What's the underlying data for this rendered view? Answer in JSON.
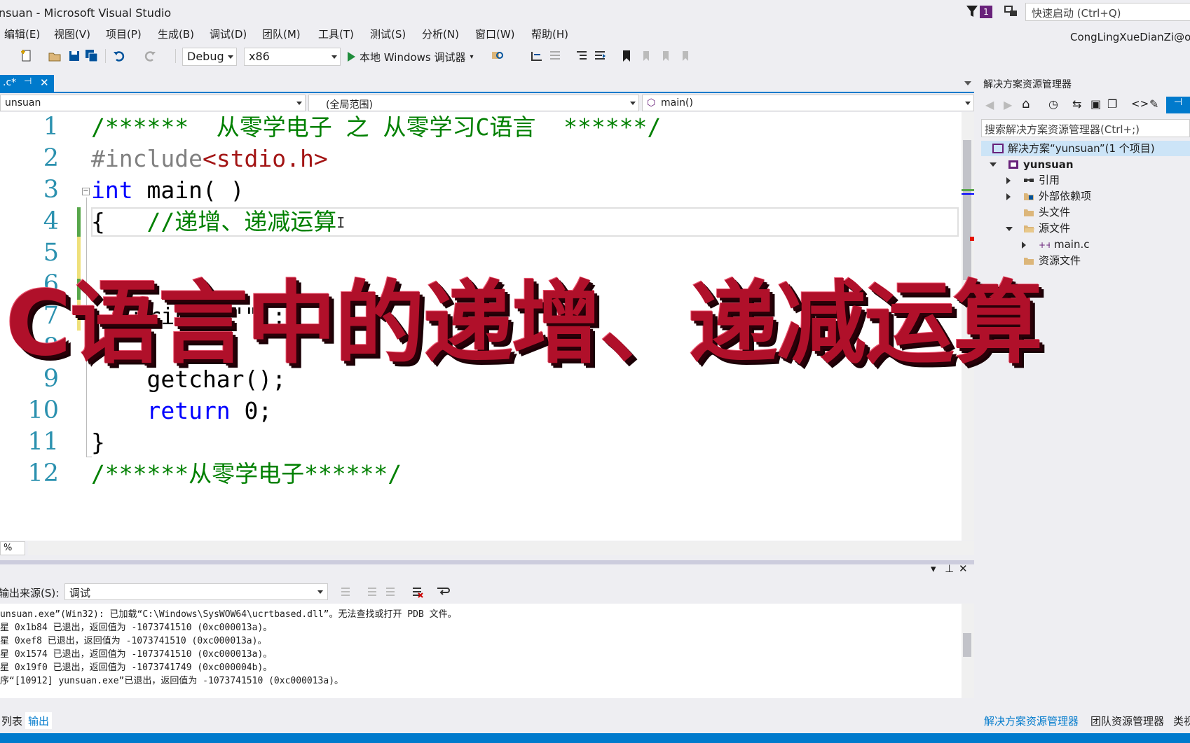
{
  "window": {
    "title": "nsuan - Microsoft Visual Studio",
    "notif_count": "1",
    "quick_launch_placeholder": "快速启动 (Ctrl+Q)",
    "account": "CongLingXueDianZi@o"
  },
  "menu": [
    "编辑(E)",
    "视图(V)",
    "项目(P)",
    "生成(B)",
    "调试(D)",
    "团队(M)",
    "工具(T)",
    "测试(S)",
    "分析(N)",
    "窗口(W)",
    "帮助(H)"
  ],
  "toolbar": {
    "config": "Debug",
    "platform": "x86",
    "run_label": "本地 Windows 调试器"
  },
  "doc_tab": {
    "name": ".c*",
    "pin": "⊣",
    "close": "✕"
  },
  "navbar": {
    "project": "unsuan",
    "scope": "(全局范围)",
    "member": "main()"
  },
  "code": {
    "line_numbers": [
      "1",
      "2",
      "3",
      "4",
      "5",
      "6",
      "7",
      "8",
      "9",
      "10",
      "11",
      "12"
    ],
    "l1": "/******  从零学电子 之 从零学习C语言  ******/",
    "l2a": "#include",
    "l2b": "<stdio.h>",
    "l3a": "int",
    "l3b": " main( )",
    "l4a": "{   ",
    "l4b": "//递增、递减运算",
    "l7": "   printf(\"\");",
    "l9": "    getchar();",
    "l10a": "    return",
    "l10b": " 0;",
    "l11": "}",
    "l12": "/******从零学电子******/",
    "zoom": "%"
  },
  "overlay": {
    "title": "C语言中的递增、递减运算"
  },
  "output": {
    "source_label": "输出来源(S):",
    "source_value": "调试",
    "lines": [
      "unsuan.exe”(Win32): 已加载“C:\\Windows\\SysWOW64\\ucrtbased.dll”。无法查找或打开 PDB 文件。",
      "星 0x1b84 已退出，返回值为 -1073741510 (0xc000013a)。",
      "星 0xef8 已退出，返回值为 -1073741510 (0xc000013a)。",
      "星 0x1574 已退出，返回值为 -1073741510 (0xc000013a)。",
      "星 0x19f0 已退出，返回值为 -1073741749 (0xc000004b)。",
      "序“[10912] yunsuan.exe”已退出，返回值为 -1073741510 (0xc000013a)。"
    ],
    "tabs": [
      "列表",
      "输出"
    ]
  },
  "solution_explorer": {
    "title": "解决方案资源管理器",
    "search_placeholder": "搜索解决方案资源管理器(Ctrl+;)",
    "solution": "解决方案“yunsuan”(1 个项目)",
    "project": "yunsuan",
    "items": [
      "引用",
      "外部依赖项",
      "头文件",
      "源文件",
      "main.c",
      "资源文件"
    ],
    "bottom_tabs": [
      "解决方案资源管理器",
      "团队资源管理器",
      "类视"
    ]
  },
  "colors": {
    "accent": "#007acc",
    "overlay_red": "#b0102a",
    "comment_green": "#008000",
    "keyword_blue": "#0000ff"
  }
}
